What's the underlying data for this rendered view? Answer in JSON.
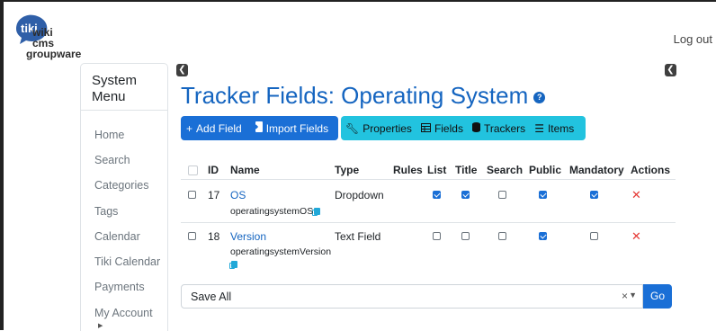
{
  "header": {
    "logo_text": [
      "wiki",
      "cms",
      "groupware"
    ],
    "logo_mark": "tiki",
    "logout_label": "Log out"
  },
  "sidebar": {
    "title_line1": "System",
    "title_line2": "Menu",
    "items": [
      {
        "label": "Home"
      },
      {
        "label": "Search"
      },
      {
        "label": "Categories"
      },
      {
        "label": "Tags"
      },
      {
        "label": "Calendar"
      },
      {
        "label": "Tiki Calendar"
      },
      {
        "label": "Payments"
      },
      {
        "label": "My Account"
      }
    ]
  },
  "main": {
    "title": "Tracker Fields: Operating System",
    "primary_buttons": [
      {
        "label": "Add Field",
        "icon": "plus-icon"
      },
      {
        "label": "Import Fields",
        "icon": "import-icon"
      }
    ],
    "secondary_buttons": [
      {
        "label": "Properties",
        "icon": "wrench-icon"
      },
      {
        "label": "Fields",
        "icon": "table-icon"
      },
      {
        "label": "Trackers",
        "icon": "database-icon"
      },
      {
        "label": "Items",
        "icon": "list-icon"
      }
    ]
  },
  "table": {
    "columns": [
      "ID",
      "Name",
      "Type",
      "Rules",
      "List",
      "Title",
      "Search",
      "Public",
      "Mandatory",
      "Actions"
    ],
    "rows": [
      {
        "id": "17",
        "name": "OS",
        "perm": "operatingsystemOS",
        "type": "Dropdown",
        "list": true,
        "title": true,
        "search": false,
        "public": true,
        "mandatory": true
      },
      {
        "id": "18",
        "name": "Version",
        "perm": "operatingsystemVersion",
        "type": "Text Field",
        "list": false,
        "title": false,
        "search": false,
        "public": true,
        "mandatory": false
      }
    ]
  },
  "bulk": {
    "selected": "Save All",
    "clear_symbol": "×",
    "go_label": "Go"
  },
  "colors": {
    "primary": "#1a6fd6",
    "info": "#22c3df",
    "title": "#1565c0",
    "danger": "#e53935"
  }
}
